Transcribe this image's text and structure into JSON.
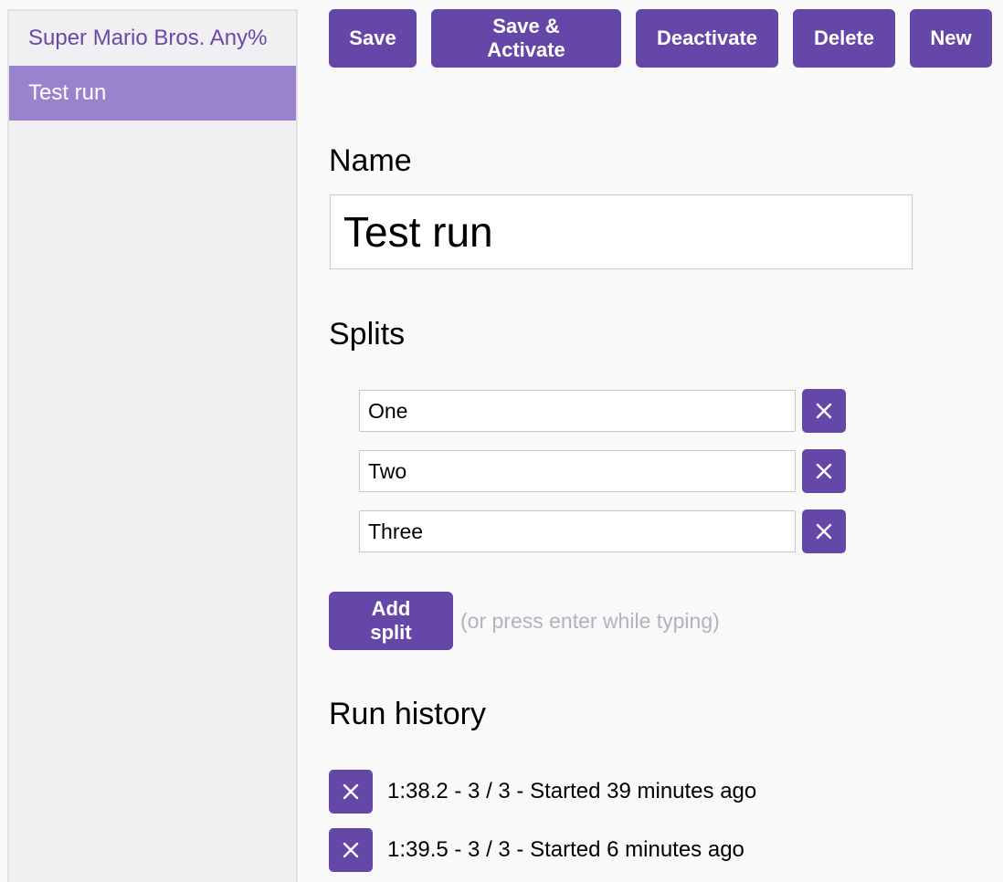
{
  "sidebar": {
    "items": [
      {
        "label": "Super Mario Bros. Any%",
        "active": false
      },
      {
        "label": "Test run",
        "active": true
      }
    ]
  },
  "toolbar": {
    "save_label": "Save",
    "save_activate_label": "Save & Activate",
    "deactivate_label": "Deactivate",
    "delete_label": "Delete",
    "new_label": "New"
  },
  "form": {
    "name_heading": "Name",
    "name_value": "Test run",
    "splits_heading": "Splits",
    "splits": [
      {
        "value": "One"
      },
      {
        "value": "Two"
      },
      {
        "value": "Three"
      }
    ],
    "add_split_label": "Add split",
    "add_split_hint": "(or press enter while typing)"
  },
  "history": {
    "heading": "Run history",
    "runs": [
      {
        "text": "1:38.2 - 3 / 3 - Started 39 minutes ago"
      },
      {
        "text": "1:39.5 - 3 / 3 - Started 6 minutes ago"
      }
    ]
  },
  "colors": {
    "accent": "#6547a8",
    "sidebar_active": "#9b82cc",
    "sidebar_link": "#6a48a8",
    "hint": "#b5b0bd"
  },
  "icons": {
    "remove": "close-icon"
  }
}
